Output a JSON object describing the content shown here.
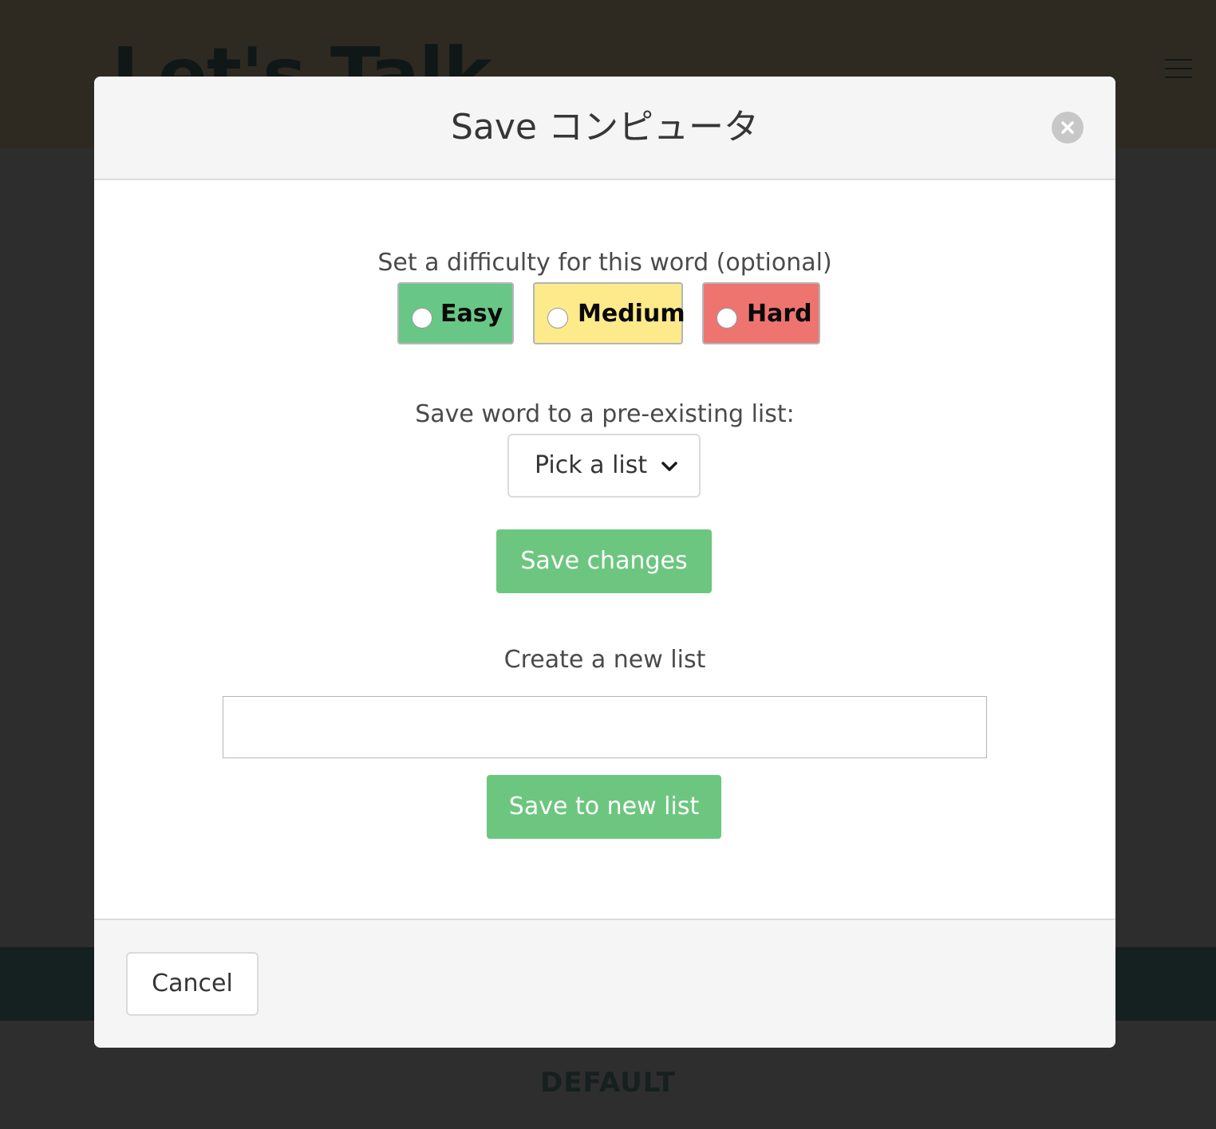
{
  "background": {
    "site_title": "Let's Talk",
    "footer_label": "DEFAULT",
    "menu_icon": "hamburger-icon"
  },
  "modal": {
    "title": "Save コンピュータ",
    "close_icon": "close-icon",
    "difficulty": {
      "label": "Set a difficulty for this word (optional)",
      "options": [
        {
          "label": "Easy",
          "color": "#68c787",
          "selected": false
        },
        {
          "label": "Medium",
          "color": "#fdea8b",
          "selected": false
        },
        {
          "label": "Hard",
          "color": "#ee7470",
          "selected": false
        }
      ]
    },
    "existing_list": {
      "label": "Save word to a pre-existing list:",
      "select_value": "Pick a list",
      "select_icon": "chevron-down-icon"
    },
    "save_changes_label": "Save changes",
    "new_list": {
      "label": "Create a new list",
      "input_value": "",
      "input_placeholder": "",
      "button_label": "Save to new list"
    },
    "footer": {
      "cancel_label": "Cancel"
    }
  },
  "colors": {
    "primary_green": "#6dc67f",
    "header_bg": "#f5f5f5",
    "overlay": "#2d2d2d"
  }
}
